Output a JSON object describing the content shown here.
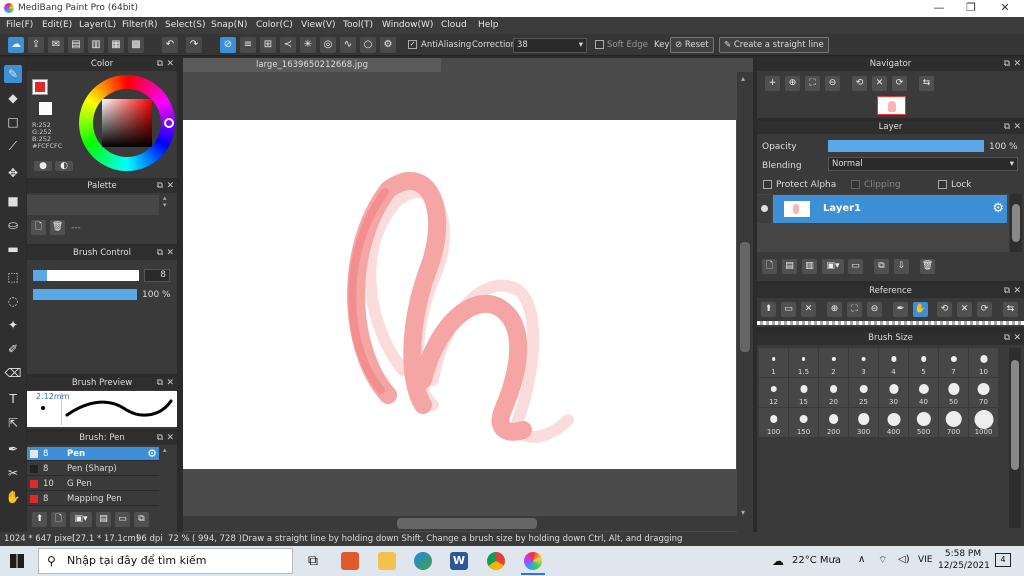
{
  "app": {
    "title": "MediBang Paint Pro (64bit)"
  },
  "menu": [
    "File(F)",
    "Edit(E)",
    "Layer(L)",
    "Filter(R)",
    "Select(S)",
    "Snap(N)",
    "Color(C)",
    "View(V)",
    "Tool(T)",
    "Window(W)",
    "Cloud",
    "Help"
  ],
  "toolbar": {
    "antialiasing_label": "AntiAliasing",
    "correction_label": "Correction",
    "correction_value": "38",
    "soft_edge_label": "Soft Edge",
    "key_label": "Key",
    "reset_label": "Reset",
    "straight_line_label": "Create a straight line"
  },
  "document": {
    "tab_title": "large_1639650212668.jpg"
  },
  "color_panel": {
    "title": "Color",
    "rgb_r": "R:252",
    "rgb_g": "G:252",
    "rgb_b": "B:252",
    "hex": "#FCFCFC",
    "primary_color": "#e3262b",
    "secondary_color": "#fcfcfc"
  },
  "palette_panel": {
    "title": "Palette",
    "placeholder": "---"
  },
  "brush_control": {
    "title": "Brush Control",
    "size_value": "8",
    "opacity_value": "100 %"
  },
  "brush_preview": {
    "title": "Brush Preview",
    "size_label": "2.12mm"
  },
  "brush_list": {
    "title": "Brush: Pen",
    "items": [
      {
        "size": "8",
        "name": "Pen",
        "color": "#e6e6e6"
      },
      {
        "size": "8",
        "name": "Pen (Sharp)",
        "color": "#222222"
      },
      {
        "size": "10",
        "name": "G Pen",
        "color": "#e02a2a"
      },
      {
        "size": "8",
        "name": "Mapping Pen",
        "color": "#e02a2a"
      }
    ]
  },
  "navigator": {
    "title": "Navigator"
  },
  "layer_panel": {
    "title": "Layer",
    "opacity_label": "Opacity",
    "opacity_value": "100 %",
    "opacity_fraction": 1.0,
    "blending_label": "Blending",
    "blending_value": "Normal",
    "protect_alpha_label": "Protect Alpha",
    "clipping_label": "Clipping",
    "lock_label": "Lock",
    "layers": [
      {
        "name": "Layer1"
      }
    ]
  },
  "reference": {
    "title": "Reference"
  },
  "brush_size": {
    "title": "Brush Size",
    "sizes": [
      "1",
      "1.5",
      "2",
      "3",
      "4",
      "5",
      "7",
      "10",
      "12",
      "15",
      "20",
      "25",
      "30",
      "40",
      "50",
      "70",
      "100",
      "150",
      "200",
      "300",
      "400",
      "500",
      "700",
      "1000"
    ]
  },
  "statusbar": {
    "dimensions": "1024 * 647 pixel",
    "physical": "(27.1 * 17.1cm)",
    "dpi": "96 dpi",
    "zoom": "72 %",
    "coords": "( 994, 728 )",
    "hint": "Draw a straight line by holding down Shift, Change a brush size by holding down Ctrl, Alt, and dragging"
  },
  "taskbar": {
    "search_placeholder": "Nhập tại đây để tìm kiếm",
    "weather": "22°C  Mưa",
    "lang": "VIE",
    "time": "5:58 PM",
    "date": "12/25/2021",
    "notifications": "4"
  },
  "colors": {
    "accent": "#3d8fd6",
    "stroke_pink": "#f4a4a4"
  }
}
